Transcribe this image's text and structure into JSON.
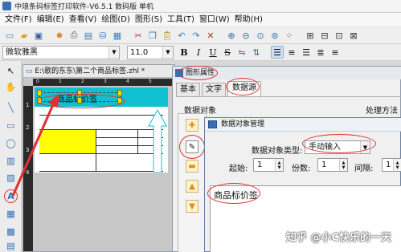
{
  "window": {
    "title": "中琅条码标签打印软件-V6.5.1 数码版 单机"
  },
  "menu": {
    "items": [
      "文件(F)",
      "编辑(E)",
      "查看(V)",
      "绘图(D)",
      "图形(S)",
      "工具(T)",
      "窗口(W)",
      "帮助(H)"
    ]
  },
  "fontbar": {
    "font_name": "微软雅黑",
    "font_size": "11.0"
  },
  "document": {
    "title": "E:\\歌的东东\\第二个商品标签.zhl *",
    "ruler_marks": [
      "0",
      "1",
      "2",
      "3",
      "4",
      "5"
    ],
    "label_text": "商品标价签"
  },
  "properties": {
    "title": "图形属性",
    "tabs": [
      "基本",
      "文字",
      "数据源"
    ],
    "active_tab": "数据源",
    "section_label": "数据对象",
    "method_label": "处理方法"
  },
  "data_dialog": {
    "title": "数据对象管理",
    "type_label": "数据对象类型:",
    "type_value": "手动输入",
    "start_label": "起始:",
    "start_value": "1",
    "copies_label": "份数:",
    "copies_value": "1",
    "interval_label": "间隔:",
    "interval_value": "1",
    "content": "商品标价签"
  },
  "watermark": "知乎 @小C快乐的一天",
  "colors": {
    "canvas_bg": "#10c0d0",
    "highlight": "#ffff00",
    "annotation": "#e0332f",
    "arrow": "#e03030"
  }
}
